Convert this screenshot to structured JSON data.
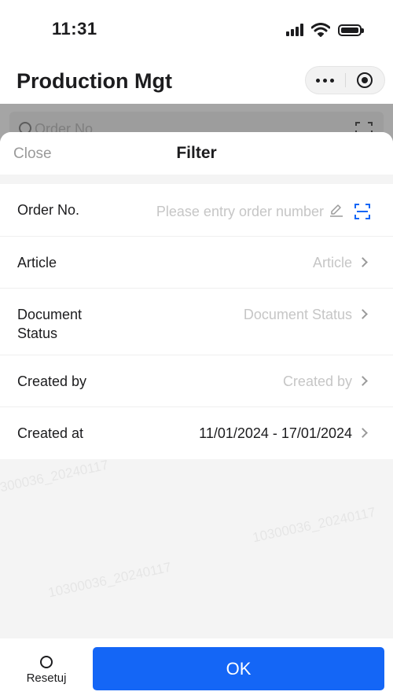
{
  "status_bar": {
    "time": "11:31"
  },
  "header": {
    "title": "Production Mgt"
  },
  "background": {
    "search_placeholder": "Order No."
  },
  "filter": {
    "close_label": "Close",
    "title": "Filter",
    "fields": {
      "order_no": {
        "label": "Order No.",
        "placeholder": "Please entry order number"
      },
      "article": {
        "label": "Article",
        "placeholder": "Article"
      },
      "document_status": {
        "label_line1": "Document",
        "label_line2": "Status",
        "placeholder": "Document Status"
      },
      "created_by": {
        "label": "Created by",
        "placeholder": "Created by"
      },
      "created_at": {
        "label": "Created at",
        "value": "11/01/2024 - 17/01/2024"
      }
    }
  },
  "footer": {
    "reset_label": "Resetuj",
    "ok_label": "OK"
  },
  "watermark_text": "10300036_20240117",
  "colors": {
    "primary": "#1466f6",
    "placeholder": "#c6c6c6",
    "sheet_bg": "#f4f4f4",
    "overlay": "#a5a5a5"
  }
}
